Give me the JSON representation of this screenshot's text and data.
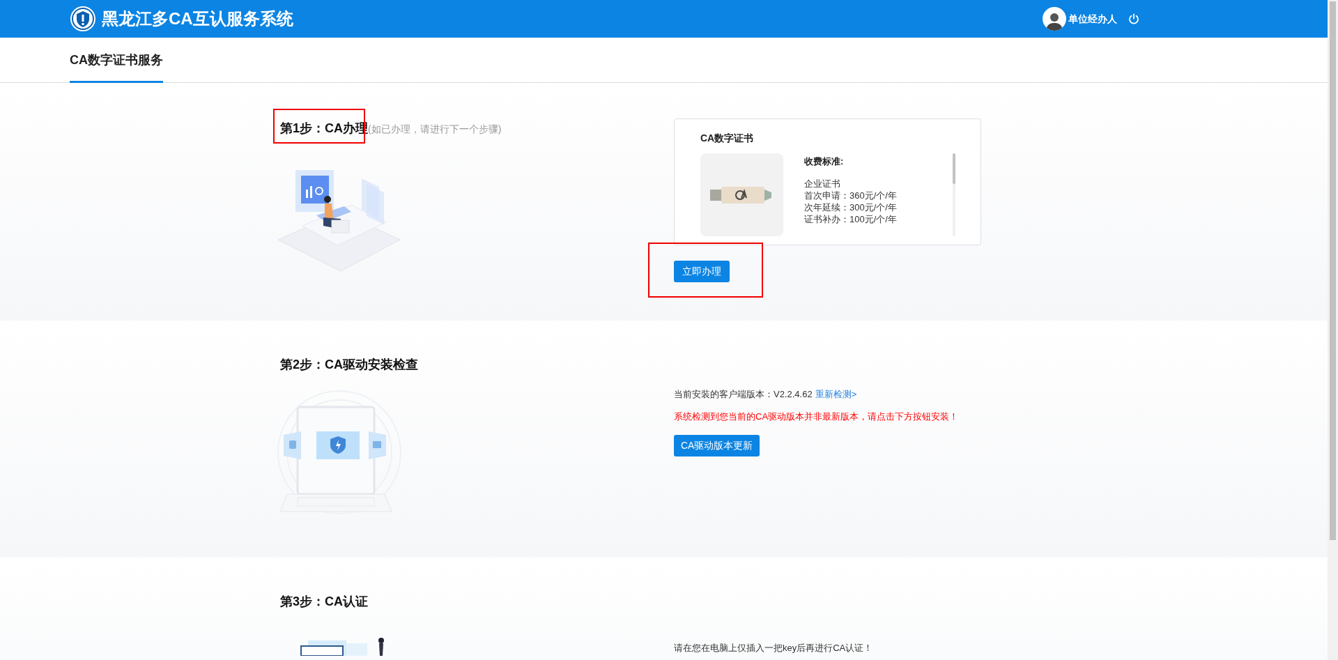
{
  "header": {
    "title": "黑龙江多CA互认服务系统",
    "user": "单位经办人"
  },
  "tabs": [
    {
      "label": "CA数字证书服务",
      "selected": true
    }
  ],
  "steps": [
    {
      "kind": "apply",
      "title": "第1步：CA办理",
      "hint": "(如已办理，请进行下一个步骤)",
      "highlighted": true,
      "card": {
        "title": "CA数字证书",
        "fee_title": "收费标准:",
        "lines": [
          "企业证书",
          "首次申请：360元/个/年",
          "次年延续：300元/个/年",
          "证书补办：100元/个/年"
        ]
      },
      "button": {
        "label": "立即办理",
        "highlighted": true
      }
    },
    {
      "kind": "driver",
      "title": "第2步：CA驱动安装检查",
      "version_text": "当前安装的客户端版本：V2.2.4.62",
      "recheck_link": "重新检测>",
      "warning": "系统检测到您当前的CA驱动版本并非最新版本，请点击下方按钮安装！",
      "button": {
        "label": "CA驱动版本更新",
        "highlighted": false
      }
    },
    {
      "kind": "auth",
      "title": "第3步：CA认证",
      "message": "请在您在电脑上仅插入一把key后再进行CA认证！"
    }
  ]
}
